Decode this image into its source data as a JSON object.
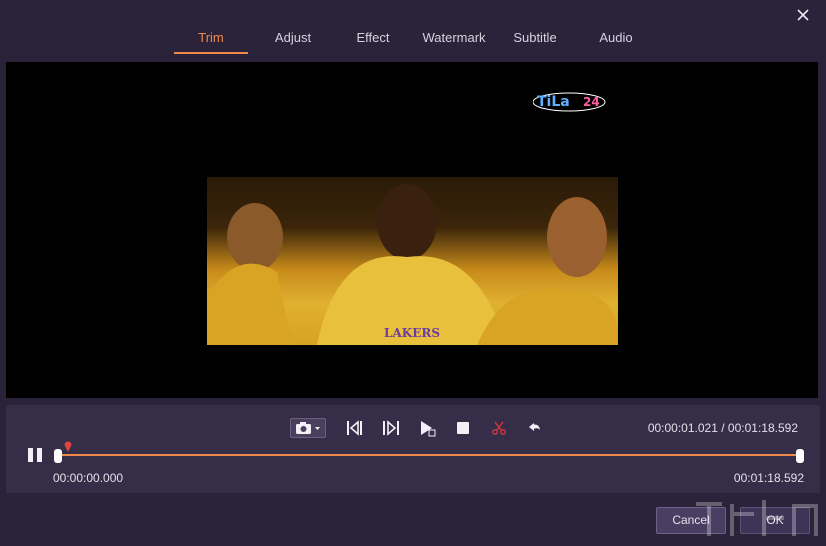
{
  "tabs": [
    {
      "label": "Trim",
      "active": true
    },
    {
      "label": "Adjust",
      "active": false
    },
    {
      "label": "Effect",
      "active": false
    },
    {
      "label": "Watermark",
      "active": false
    },
    {
      "label": "Subtitle",
      "active": false
    },
    {
      "label": "Audio",
      "active": false
    }
  ],
  "video": {
    "logo_text": "Tilaato24"
  },
  "player": {
    "current_time": "00:00:01.021",
    "separator": "/",
    "total_time": "00:01:18.592",
    "trim_start": "00:00:00.000",
    "trim_end": "00:01:18.592",
    "playhead_fraction": 0.013
  },
  "footer": {
    "cancel_label": "Cancel",
    "ok_label": "OK"
  },
  "colors": {
    "accent": "#f08a4b",
    "background": "#2a2238",
    "control_panel": "#362d48"
  },
  "icons": [
    "close-icon",
    "camera-icon",
    "previous-frame-icon",
    "next-frame-icon",
    "play-segment-icon",
    "stop-icon",
    "scissors-icon",
    "undo-icon",
    "pause-icon"
  ]
}
